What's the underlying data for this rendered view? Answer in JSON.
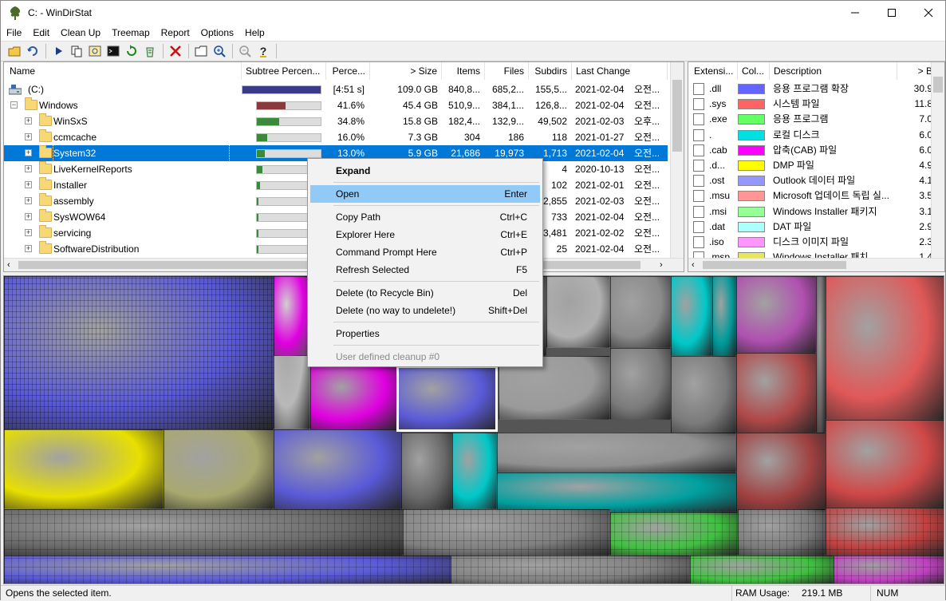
{
  "window": {
    "title": "C: - WinDirStat",
    "min_icon": "minimize-icon",
    "max_icon": "maximize-icon",
    "close_icon": "close-icon"
  },
  "menu": [
    "File",
    "Edit",
    "Clean Up",
    "Treemap",
    "Report",
    "Options",
    "Help"
  ],
  "toolbar": [
    "open-icon",
    "rescan-icon",
    "play-icon",
    "copy-icon",
    "explorer-icon",
    "cmd-icon",
    "refresh-icon",
    "recycle-icon",
    "delete-icon",
    "folder-icon",
    "zoom-in-icon",
    "zoom-out-icon",
    "help-icon"
  ],
  "tree": {
    "headers": [
      "Name",
      "Subtree Percen...",
      "Perce...",
      "> Size",
      "Items",
      "Files",
      "Subdirs",
      "Last Change"
    ],
    "rows": [
      {
        "name": "(C:)",
        "perc": "[4:51 s]",
        "size": "109.0 GB",
        "items": "840,8...",
        "files": "685,2...",
        "subdirs": "155,5...",
        "date": "2021-02-04",
        "time": "오전...",
        "fill": 1.0,
        "color": "#3a3a8a"
      },
      {
        "name": "Windows",
        "perc": "41.6%",
        "size": "45.4 GB",
        "items": "510,9...",
        "files": "384,1...",
        "subdirs": "126,8...",
        "date": "2021-02-04",
        "time": "오전...",
        "fill": 0.45,
        "color": "#8a3a3a"
      },
      {
        "name": "WinSxS",
        "perc": "34.8%",
        "size": "15.8 GB",
        "items": "182,4...",
        "files": "132,9...",
        "subdirs": "49,502",
        "date": "2021-02-03",
        "time": "오후...",
        "fill": 0.35,
        "color": "#3a8a3a"
      },
      {
        "name": "ccmcache",
        "perc": "16.0%",
        "size": "7.3 GB",
        "items": "304",
        "files": "186",
        "subdirs": "118",
        "date": "2021-01-27",
        "time": "오전...",
        "fill": 0.16,
        "color": "#3a8a3a"
      },
      {
        "name": "System32",
        "perc": "13.0%",
        "size": "5.9 GB",
        "items": "21,686",
        "files": "19,973",
        "subdirs": "1,713",
        "date": "2021-02-04",
        "time": "오전...",
        "fill": 0.13,
        "color": "#3a8a3a"
      },
      {
        "name": "LiveKernelReports",
        "perc": "",
        "size": "",
        "items": "",
        "files": "",
        "subdirs": "4",
        "date": "2020-10-13",
        "time": "오전...",
        "fill": 0.09,
        "color": "#3a8a3a"
      },
      {
        "name": "Installer",
        "perc": "",
        "size": "",
        "items": "",
        "files": "",
        "subdirs": "102",
        "date": "2021-02-01",
        "time": "오전...",
        "fill": 0.05,
        "color": "#3a8a3a"
      },
      {
        "name": "assembly",
        "perc": "",
        "size": "",
        "items": "",
        "files": "",
        "subdirs": "2,855",
        "date": "2021-02-03",
        "time": "오전...",
        "fill": 0.03,
        "color": "#3a8a3a"
      },
      {
        "name": "SysWOW64",
        "perc": "",
        "size": "",
        "items": "",
        "files": "",
        "subdirs": "733",
        "date": "2021-02-04",
        "time": "오전...",
        "fill": 0.03,
        "color": "#3a8a3a"
      },
      {
        "name": "servicing",
        "perc": "",
        "size": "",
        "items": "",
        "files": "",
        "subdirs": "3,481",
        "date": "2021-02-02",
        "time": "오전...",
        "fill": 0.02,
        "color": "#3a8a3a"
      },
      {
        "name": "SoftwareDistribution",
        "perc": "",
        "size": "",
        "items": "",
        "files": "",
        "subdirs": "25",
        "date": "2021-02-04",
        "time": "오전...",
        "fill": 0.02,
        "color": "#3a8a3a"
      }
    ]
  },
  "ext": {
    "headers": [
      "Extensi...",
      "Col...",
      "Description",
      "> B"
    ],
    "rows": [
      {
        "ext": ".dll",
        "color": "#6464ff",
        "desc": "응용 프로그램 확장",
        "bytes": "30.9"
      },
      {
        "ext": ".sys",
        "color": "#ff6464",
        "desc": "시스템 파일",
        "bytes": "11.8"
      },
      {
        "ext": ".exe",
        "color": "#64ff64",
        "desc": "응용 프로그램",
        "bytes": "7.0"
      },
      {
        "ext": ".",
        "color": "#00e0e0",
        "desc": "로컬 디스크",
        "bytes": "6.0"
      },
      {
        "ext": ".cab",
        "color": "#ff00ff",
        "desc": "압축(CAB) 파일",
        "bytes": "6.0"
      },
      {
        "ext": ".d...",
        "color": "#ffff00",
        "desc": "DMP 파일",
        "bytes": "4.9"
      },
      {
        "ext": ".ost",
        "color": "#9696ff",
        "desc": "Outlook 데이터 파일",
        "bytes": "4.1"
      },
      {
        "ext": ".msu",
        "color": "#ff9696",
        "desc": "Microsoft 업데이트 독립 실...",
        "bytes": "3.5"
      },
      {
        "ext": ".msi",
        "color": "#96ff96",
        "desc": "Windows Installer 패키지",
        "bytes": "3.1"
      },
      {
        "ext": ".dat",
        "color": "#aaffff",
        "desc": "DAT 파일",
        "bytes": "2.9"
      },
      {
        "ext": ".iso",
        "color": "#ff96ff",
        "desc": "디스크 이미지 파일",
        "bytes": "2.3"
      },
      {
        "ext": ".msp",
        "color": "#e6e65a",
        "desc": "Windows Installer 패치",
        "bytes": "1.4"
      }
    ]
  },
  "context_menu": [
    {
      "label": "Expand",
      "key": "",
      "style": "bold"
    },
    {
      "sep": true
    },
    {
      "label": "Open",
      "key": "Enter",
      "style": "hl"
    },
    {
      "sep": true
    },
    {
      "label": "Copy Path",
      "key": "Ctrl+C"
    },
    {
      "label": "Explorer Here",
      "key": "Ctrl+E"
    },
    {
      "label": "Command Prompt Here",
      "key": "Ctrl+P"
    },
    {
      "label": "Refresh Selected",
      "key": "F5"
    },
    {
      "sep": true
    },
    {
      "label": "Delete (to Recycle Bin)",
      "key": "Del"
    },
    {
      "label": "Delete (no way to undelete!)",
      "key": "Shift+Del"
    },
    {
      "sep": true
    },
    {
      "label": "Properties",
      "key": ""
    },
    {
      "sep": true
    },
    {
      "label": "User defined cleanup #0",
      "key": "",
      "style": "dis"
    }
  ],
  "status": {
    "message": "Opens the selected item.",
    "ram_label": "RAM Usage:",
    "ram_value": "219.1 MB",
    "num": "NUM"
  }
}
